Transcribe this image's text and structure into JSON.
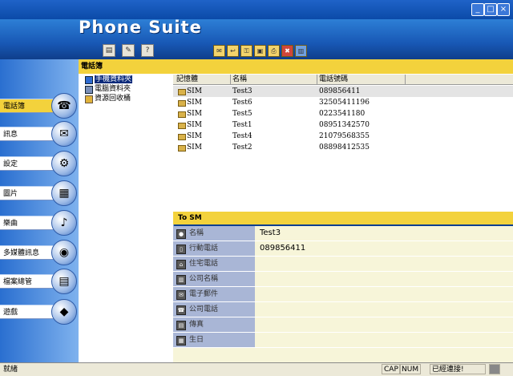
{
  "brand": "Phone Suite",
  "window_buttons": [
    "_",
    "□",
    "×"
  ],
  "toolbar_primary": [
    "▤",
    "✎",
    "?"
  ],
  "toolbar_secondary": [
    "✉",
    "↩",
    "⚿",
    "▣",
    "⎙",
    "✖",
    "▥"
  ],
  "nav": [
    {
      "label": "電話簿",
      "icon": "phone-icon",
      "glyph": "☎"
    },
    {
      "label": "訊息",
      "icon": "message-icon",
      "glyph": "✉"
    },
    {
      "label": "設定",
      "icon": "settings-icon",
      "glyph": "⚙"
    },
    {
      "label": "圖片",
      "icon": "picture-icon",
      "glyph": "▦"
    },
    {
      "label": "樂曲",
      "icon": "music-icon",
      "glyph": "♪"
    },
    {
      "label": "多媒體訊息",
      "icon": "mms-icon",
      "glyph": "◉"
    },
    {
      "label": "檔案總管",
      "icon": "file-manager-icon",
      "glyph": "▤"
    },
    {
      "label": "遊戲",
      "icon": "game-icon",
      "glyph": "◆"
    }
  ],
  "panel_title": "電話簿",
  "tree": [
    {
      "label": "手機資料夾",
      "selected": true
    },
    {
      "label": "電腦資料夾",
      "selected": false
    },
    {
      "label": "資源回收桶",
      "selected": false
    }
  ],
  "list_headers": {
    "memory": "記憶體",
    "name": "名稱",
    "phone": "電話號碼"
  },
  "contacts": [
    {
      "memory": "SIM",
      "name": "Test3",
      "phone": "089856411"
    },
    {
      "memory": "SIM",
      "name": "Test6",
      "phone": "32505411196"
    },
    {
      "memory": "SIM",
      "name": "Test5",
      "phone": "0223541180"
    },
    {
      "memory": "SIM",
      "name": "Test1",
      "phone": "08951342570"
    },
    {
      "memory": "SIM",
      "name": "Test4",
      "phone": "21079568355"
    },
    {
      "memory": "SIM",
      "name": "Test2",
      "phone": "08898412535"
    }
  ],
  "detail_title": "To SM",
  "detail_fields": [
    {
      "label": "名稱",
      "value": "Test3"
    },
    {
      "label": "行動電話",
      "value": "089856411"
    },
    {
      "label": "住宅電話",
      "value": ""
    },
    {
      "label": "公司名稱",
      "value": ""
    },
    {
      "label": "電子郵件",
      "value": ""
    },
    {
      "label": "公司電話",
      "value": ""
    },
    {
      "label": "傳真",
      "value": ""
    },
    {
      "label": "生日",
      "value": ""
    }
  ],
  "status": {
    "left": "就緒",
    "cap": "CAP",
    "num": "NUM",
    "connection": "已經連接!"
  },
  "colors": {
    "accent": "#f3d23c",
    "header": "#1858b5",
    "label_bg": "#a9b6d6"
  }
}
